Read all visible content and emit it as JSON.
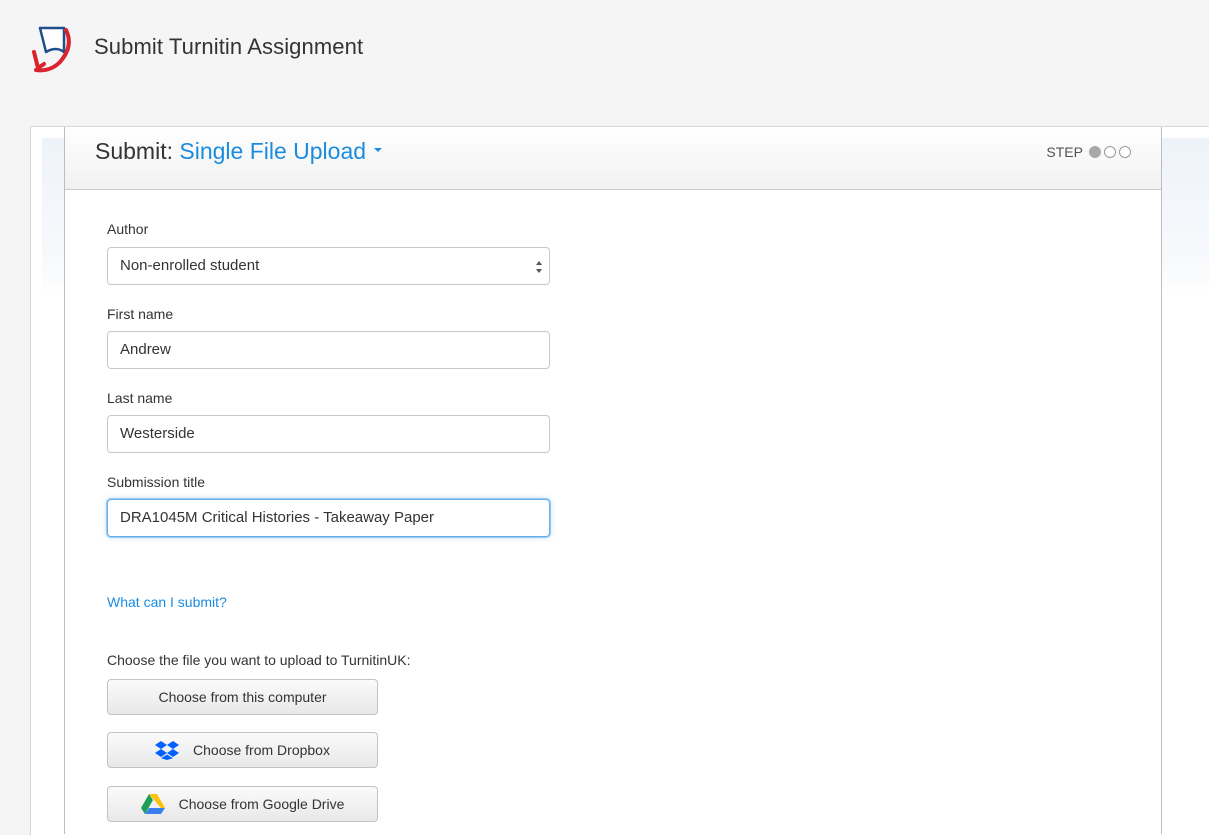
{
  "app": {
    "title": "Submit Turnitin Assignment"
  },
  "panel": {
    "title_prefix": "Submit:",
    "submission_mode": "Single File Upload",
    "step_label": "STEP",
    "step_total": 3,
    "step_current": 1
  },
  "form": {
    "author": {
      "label": "Author",
      "selected": "Non-enrolled student"
    },
    "first_name": {
      "label": "First name",
      "value": "Andrew"
    },
    "last_name": {
      "label": "Last name",
      "value": "Westerside"
    },
    "submission_title": {
      "label": "Submission title",
      "value": "DRA1045M Critical Histories - Takeaway Paper"
    }
  },
  "help_link": "What can I submit?",
  "upload": {
    "prompt": "Choose the file you want to upload to TurnitinUK:",
    "buttons": [
      {
        "label": "Choose from this computer",
        "icon": ""
      },
      {
        "label": "Choose from Dropbox",
        "icon": "dropbox-icon"
      },
      {
        "label": "Choose from Google Drive",
        "icon": "google-drive-icon"
      }
    ]
  },
  "colors": {
    "accent": "#1a8ce0",
    "logo_red": "#d9232e",
    "logo_blue": "#1f4e8c",
    "dropbox": "#0061fe",
    "focus_border": "#66afe9"
  }
}
